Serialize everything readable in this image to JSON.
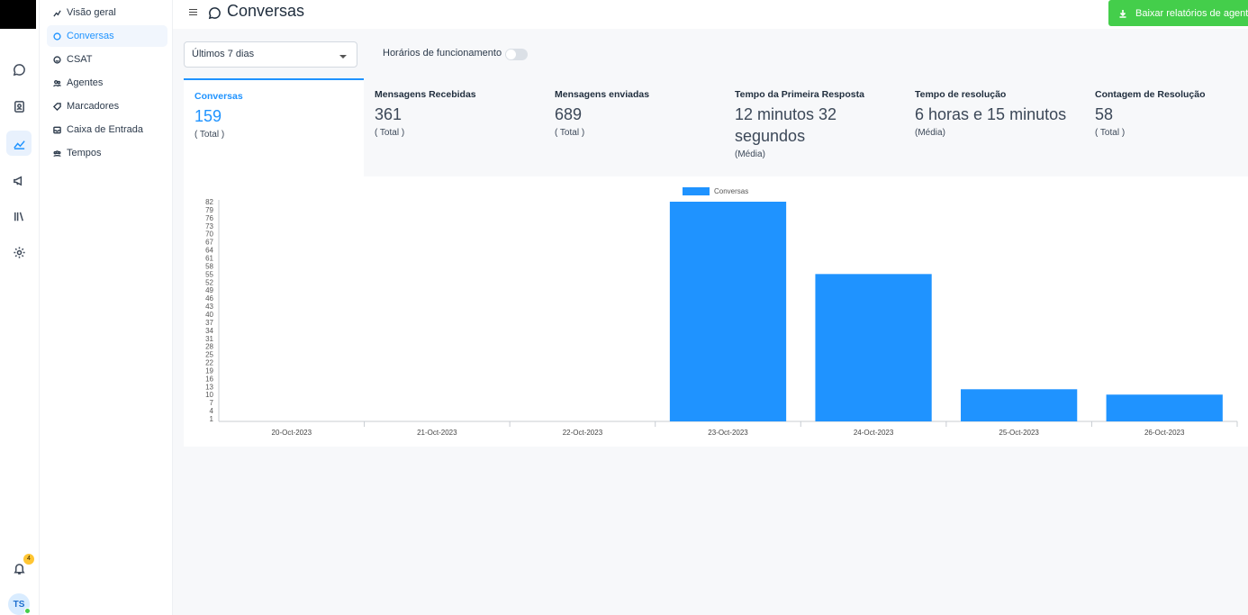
{
  "app": {
    "title": "Conversas",
    "download_label": "Baixar relatórios de agentes"
  },
  "rail": {
    "items": [
      "chat-icon",
      "contacts-icon",
      "reports-icon",
      "campaigns-icon",
      "library-icon",
      "settings-icon"
    ],
    "active": "reports-icon",
    "notification_count": "4",
    "avatar_initials": "TS"
  },
  "subnav": {
    "items": [
      {
        "label": "Visão geral",
        "icon": "chart-icon"
      },
      {
        "label": "Conversas",
        "icon": "chat-icon"
      },
      {
        "label": "CSAT",
        "icon": "smile-icon"
      },
      {
        "label": "Agentes",
        "icon": "people-icon"
      },
      {
        "label": "Marcadores",
        "icon": "tag-icon"
      },
      {
        "label": "Caixa de Entrada",
        "icon": "inbox-icon"
      },
      {
        "label": "Tempos",
        "icon": "team-icon"
      }
    ],
    "active_index": 1
  },
  "filters": {
    "range_value": "Últimos 7 dias",
    "business_hours_label": "Horários de funcionamento",
    "business_hours_on": false
  },
  "metrics": [
    {
      "label": "Conversas",
      "value": "159",
      "sub": "( Total )"
    },
    {
      "label": "Mensagens Recebidas",
      "value": "361",
      "sub": "( Total )"
    },
    {
      "label": "Mensagens enviadas",
      "value": "689",
      "sub": "( Total )"
    },
    {
      "label": "Tempo da Primeira Resposta",
      "value": "12 minutos 32 segundos",
      "sub": "(Média)"
    },
    {
      "label": "Tempo de resolução",
      "value": "6 horas e 15 minutos",
      "sub": "(Média)"
    },
    {
      "label": "Contagem de Resolução",
      "value": "58",
      "sub": "( Total )"
    }
  ],
  "chart_data": {
    "type": "bar",
    "categories": [
      "20-Oct-2023",
      "21-Oct-2023",
      "22-Oct-2023",
      "23-Oct-2023",
      "24-Oct-2023",
      "25-Oct-2023",
      "26-Oct-2023"
    ],
    "series": [
      {
        "name": "Conversas",
        "values": [
          0,
          0,
          0,
          82,
          55,
          12,
          10
        ],
        "color": "#1f93ff"
      }
    ],
    "yticks": [
      1,
      4,
      7,
      10,
      13,
      16,
      19,
      22,
      25,
      28,
      31,
      34,
      37,
      40,
      43,
      46,
      49,
      52,
      55,
      58,
      61,
      64,
      67,
      70,
      73,
      76,
      79,
      82
    ],
    "ylim": [
      0,
      82
    ],
    "legend": "top-center",
    "grid": false
  }
}
